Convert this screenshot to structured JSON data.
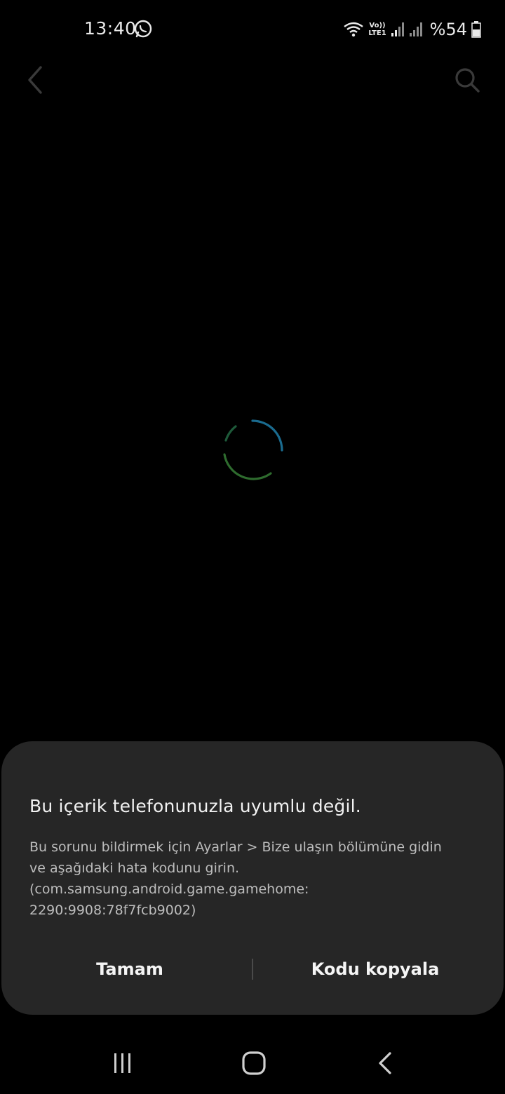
{
  "status_bar": {
    "time": "13:40",
    "volte_line1": "Vo))",
    "volte_line2": "LTE1",
    "battery": "%54",
    "icons": [
      "whatsapp-icon",
      "wifi-icon",
      "signal-icon",
      "signal-icon-2",
      "battery-icon"
    ]
  },
  "toolbar": {
    "back_icon": "chevron-left-icon",
    "search_icon": "search-icon"
  },
  "dialog": {
    "title": "Bu içerik telefonunuzla uyumlu değil.",
    "body_lines": [
      "Bu sorunu bildirmek için Ayarlar > Bize ulaşın bölümüne gidin",
      "ve aşağıdaki hata kodunu girin.",
      "(com.samsung.android.game.gamehome:",
      "2290:9908:78f7fcb9002)"
    ],
    "ok_label": "Tamam",
    "copy_label": "Kodu kopyala"
  },
  "colors": {
    "background": "#000000",
    "dialog": "#262626",
    "spinner_blue": "#1a6b8f",
    "spinner_green": "#2e6b2e"
  },
  "nav_bar": {
    "icons": [
      "recent-apps-icon",
      "home-icon",
      "back-icon"
    ]
  }
}
